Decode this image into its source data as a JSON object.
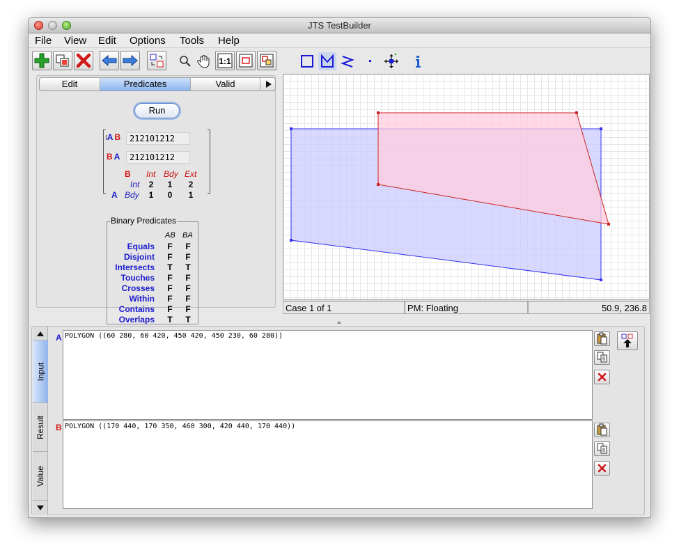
{
  "window": {
    "title": "JTS TestBuilder"
  },
  "menu": [
    "File",
    "View",
    "Edit",
    "Options",
    "Tools",
    "Help"
  ],
  "toolbar_icons": [
    "add-case-icon",
    "copy-case-icon",
    "delete-case-icon",
    "previous-case-icon",
    "next-case-icon",
    "exchange-geometries-icon",
    "zoom-icon",
    "pan-hand-icon",
    "zoom-one-to-one-icon",
    "zoom-to-input-a-icon",
    "zoom-to-inputs-icon",
    "draw-rectangle-icon",
    "draw-polygon-icon",
    "draw-linestring-icon",
    "draw-point-icon",
    "edit-vertex-icon",
    "info-icon"
  ],
  "tabs": {
    "edit": "Edit",
    "predicates": "Predicates",
    "valid": "Valid",
    "active": "Predicates"
  },
  "predicates": {
    "run_label": "Run",
    "ab_label_a": "A",
    "ab_label_b": "B",
    "ba_label_b": "B",
    "ba_label_a": "A",
    "im_ab": "212101212",
    "im_ba": "212101212",
    "de9_col_b": "B",
    "de9_cols": [
      "Int",
      "Bdy",
      "Ext"
    ],
    "de9_row_a": "A",
    "de9_rows": [
      "Int",
      "Bdy"
    ],
    "de9_values": [
      [
        "2",
        "1",
        "2"
      ],
      [
        "1",
        "0",
        "1"
      ]
    ],
    "binary_title": "Binary Predicates",
    "binary_headers": [
      "AB",
      "BA"
    ],
    "binary": [
      {
        "name": "Equals",
        "ab": "F",
        "ba": "F"
      },
      {
        "name": "Disjoint",
        "ab": "F",
        "ba": "F"
      },
      {
        "name": "Intersects",
        "ab": "T",
        "ba": "T"
      },
      {
        "name": "Touches",
        "ab": "F",
        "ba": "F"
      },
      {
        "name": "Crosses",
        "ab": "F",
        "ba": "F"
      },
      {
        "name": "Within",
        "ab": "F",
        "ba": "F"
      },
      {
        "name": "Contains",
        "ab": "F",
        "ba": "F"
      },
      {
        "name": "Overlaps",
        "ab": "T",
        "ba": "T"
      }
    ]
  },
  "canvas": {
    "colors": {
      "a_fill": "#ccccff",
      "a_stroke": "#3333ee",
      "b_fill": "#ffccdd",
      "b_stroke": "#cc2222",
      "grid": "#e6e6e6"
    }
  },
  "status": {
    "case": "Case 1 of 1",
    "precision": "PM: Floating",
    "coords": "50.9, 236.8"
  },
  "input_tabs": [
    "Input",
    "Result",
    "Value"
  ],
  "active_input_tab": "Input",
  "geometry": {
    "a_label": "A",
    "a_wkt": "POLYGON ((60 280, 60 420, 450 420, 450 230, 60 280))",
    "b_label": "B",
    "b_wkt": "POLYGON ((170 440, 170 350, 460 300, 420 440, 170 440))"
  },
  "side_button_icons": [
    "paste-icon",
    "copy-icon",
    "clear-icon",
    "load-geometry-icon"
  ]
}
